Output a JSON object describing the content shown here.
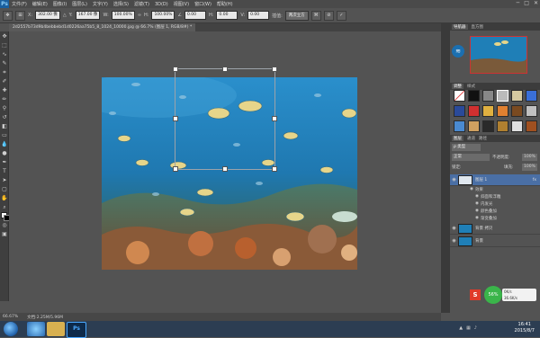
{
  "app": {
    "logo": "Ps"
  },
  "menu": {
    "items": [
      "文件(F)",
      "编辑(E)",
      "图像(I)",
      "图层(L)",
      "文字(Y)",
      "选择(S)",
      "滤镜(T)",
      "3D(D)",
      "视图(V)",
      "窗口(W)",
      "帮助(H)"
    ]
  },
  "window_controls": {
    "minimize": "─",
    "maximize": "□",
    "close": "✕"
  },
  "options": {
    "x_label": "X:",
    "x_value": "302.00 像",
    "y_label": "Y:",
    "y_value": "167.00 像",
    "w_label": "W:",
    "w_value": "100.00%",
    "h_label": "H:",
    "h_value": "100.00%",
    "angle_value": "0.00",
    "h2_label": "H:",
    "h2_value": "0.00",
    "v_label": "V:",
    "v_value": "0.00",
    "interp_label": "插值:",
    "interp_value": "两次立方"
  },
  "document": {
    "tab_title": "2d2557b73d9b4bebbebd1d0226aa75b5_8_1024_10000.jpg @ 66.7% (图层 1, RGB/8#) *"
  },
  "status": {
    "zoom": "66.67%",
    "doc_info": "文档:2.25M/5.96M"
  },
  "panels": {
    "nav_tabs": [
      "导航器",
      "直方图"
    ],
    "adjust_tabs": [
      "调整",
      "样式"
    ],
    "layer_tabs": [
      "图层",
      "通道",
      "路径"
    ],
    "kind_filter": "ρ 类型",
    "blend_mode": "正常",
    "opacity_label": "不透明度:",
    "opacity_value": "100%",
    "lock_label": "锁定:",
    "fill_label": "填充:",
    "fill_value": "100%",
    "layers": [
      {
        "name": "图层 1",
        "fx": "fx"
      },
      {
        "name": "背景 拷贝"
      },
      {
        "name": "背景"
      }
    ],
    "effects_label": "效果",
    "effects": [
      "斜面和浮雕",
      "内发光",
      "颜色叠加",
      "渐变叠加"
    ]
  },
  "widget": {
    "percent": "56%",
    "up_speed": "0K/s",
    "down_speed": "36.6K/s"
  },
  "taskbar": {
    "time": "16:41",
    "date": "2015/8/7"
  },
  "colors": {
    "accent": "#1a5f9e",
    "selection": "#4a6fa5",
    "water": "#1f7fb7"
  }
}
